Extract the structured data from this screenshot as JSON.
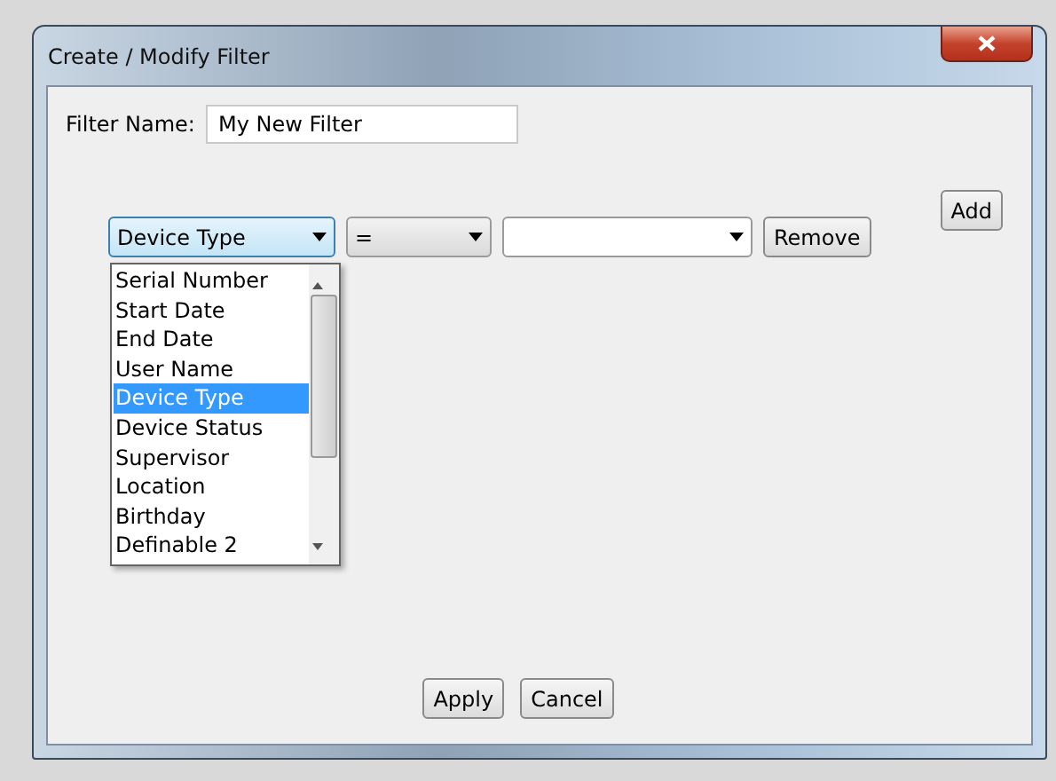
{
  "window": {
    "title": "Create / Modify Filter"
  },
  "filter_name": {
    "label": "Filter Name:",
    "value": "My New Filter"
  },
  "add_button": "Add",
  "condition": {
    "field": {
      "value": "Device Type",
      "expanded": true,
      "options": [
        {
          "label": "Serial Number",
          "selected": false
        },
        {
          "label": "Start Date",
          "selected": false
        },
        {
          "label": "End Date",
          "selected": false
        },
        {
          "label": "User Name",
          "selected": false
        },
        {
          "label": "Device Type",
          "selected": true
        },
        {
          "label": "Device Status",
          "selected": false
        },
        {
          "label": "Supervisor",
          "selected": false
        },
        {
          "label": "Location",
          "selected": false
        },
        {
          "label": "Birthday",
          "selected": false
        },
        {
          "label": "Definable 2",
          "selected": false
        }
      ]
    },
    "operator": {
      "value": "="
    },
    "remove_button": "Remove"
  },
  "buttons": [
    "Apply",
    "Cancel"
  ]
}
